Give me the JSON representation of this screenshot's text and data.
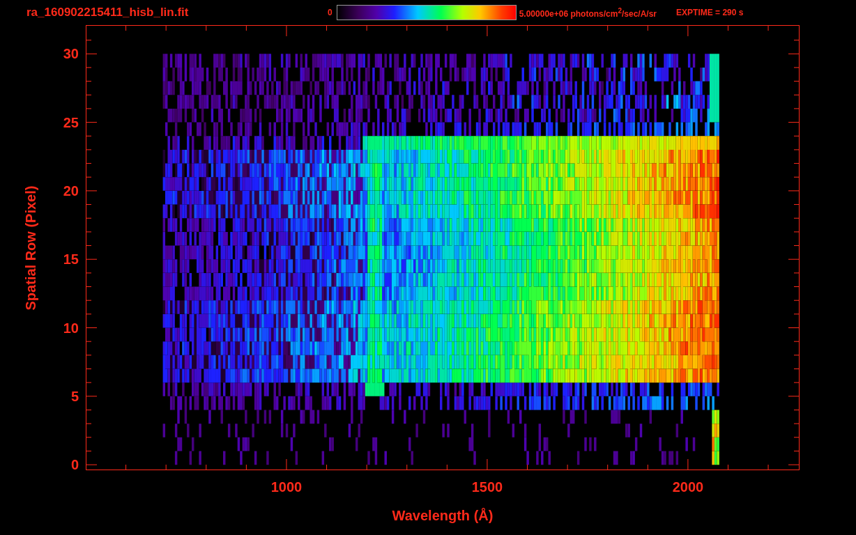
{
  "title": "ra_160902215411_hisb_lin.fit",
  "colorbar": {
    "min_label": "0",
    "max_label": "5.00000e+06 photons/cm$^{2}$/sec/A/sr"
  },
  "exposure": "EXPTIME = 290 s",
  "plot": {
    "ylabel": "Spatial Row (Pixel)",
    "yticks": [
      "30",
      "25",
      "20",
      "15",
      "10",
      "5",
      "0"
    ],
    "xticks": [
      "1000",
      "1500",
      "2000"
    ],
    "xlabel": "Wavelength (Å)"
  }
}
